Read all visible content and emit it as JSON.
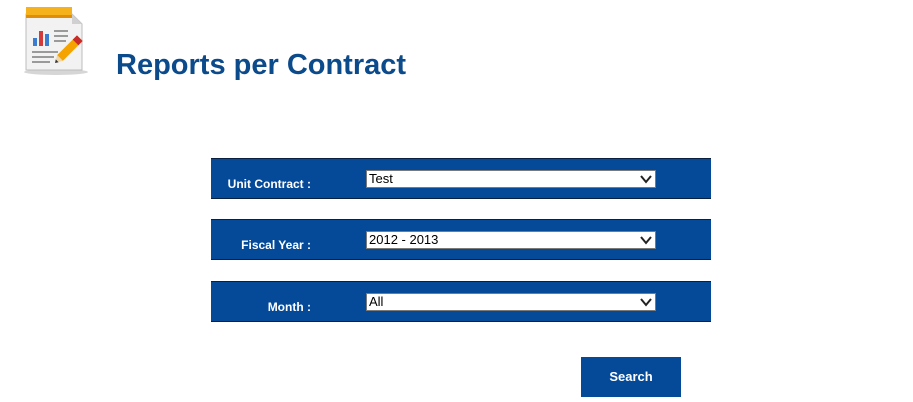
{
  "header": {
    "title": "Reports per Contract",
    "icon": "report-edit-icon"
  },
  "filters": [
    {
      "label": "Unit Contract :",
      "selected": "Test"
    },
    {
      "label": "Fiscal Year :",
      "selected": "2012 - 2013"
    },
    {
      "label": "Month :",
      "selected": "All"
    }
  ],
  "actions": {
    "search_label": "Search"
  },
  "colors": {
    "brand_blue": "#044a99",
    "title_blue": "#0b4a8b"
  }
}
